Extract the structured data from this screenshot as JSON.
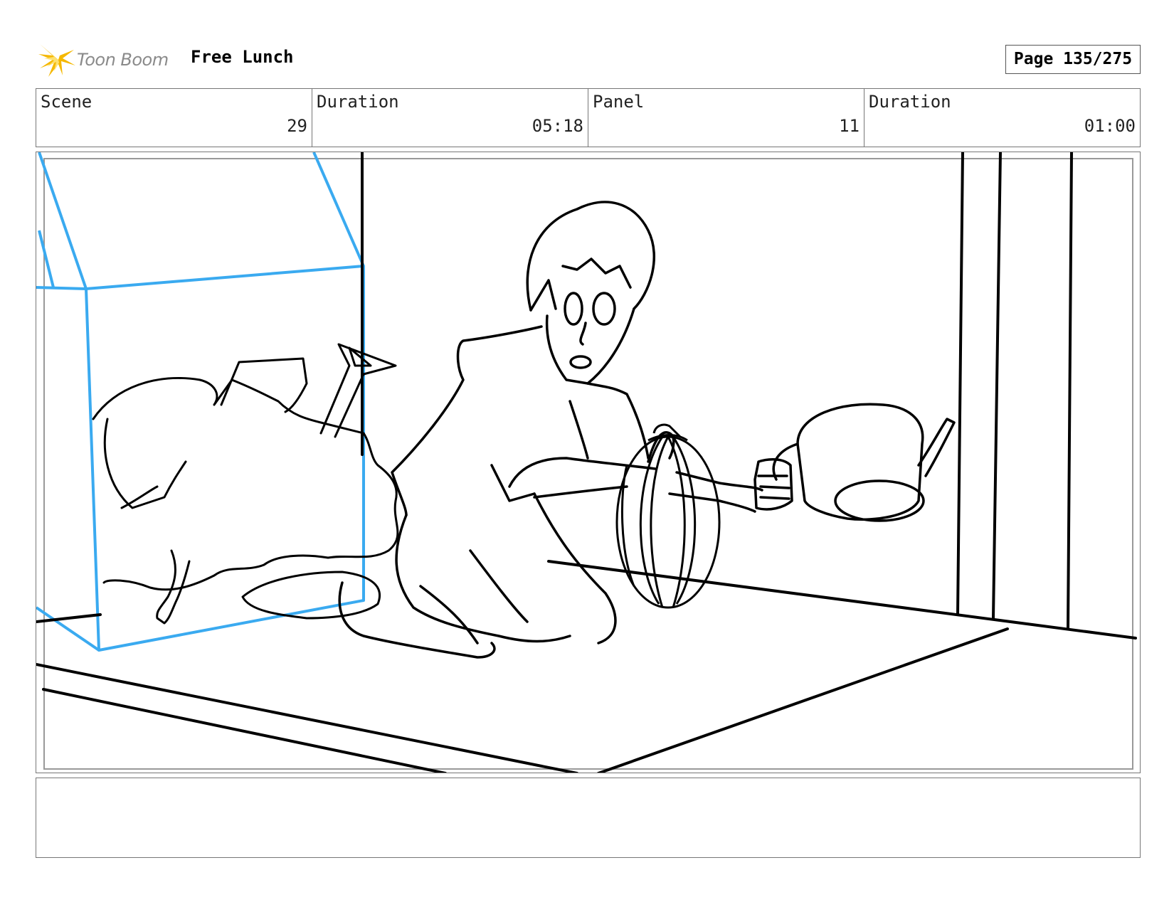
{
  "header": {
    "logo_text": "Toon Boom",
    "project_title": "Free Lunch",
    "page_label": "Page 135/275"
  },
  "info": {
    "scene_label": "Scene",
    "scene_value": "29",
    "scene_duration_label": "Duration",
    "scene_duration_value": "05:18",
    "panel_label": "Panel",
    "panel_value": "11",
    "panel_duration_label": "Duration",
    "panel_duration_value": "01:00"
  },
  "colors": {
    "logo_star": "#f5b800",
    "sketch_blue": "#3aaaf0",
    "line": "#000000"
  },
  "icons": {
    "logo": "toon-boom-star-icon"
  }
}
